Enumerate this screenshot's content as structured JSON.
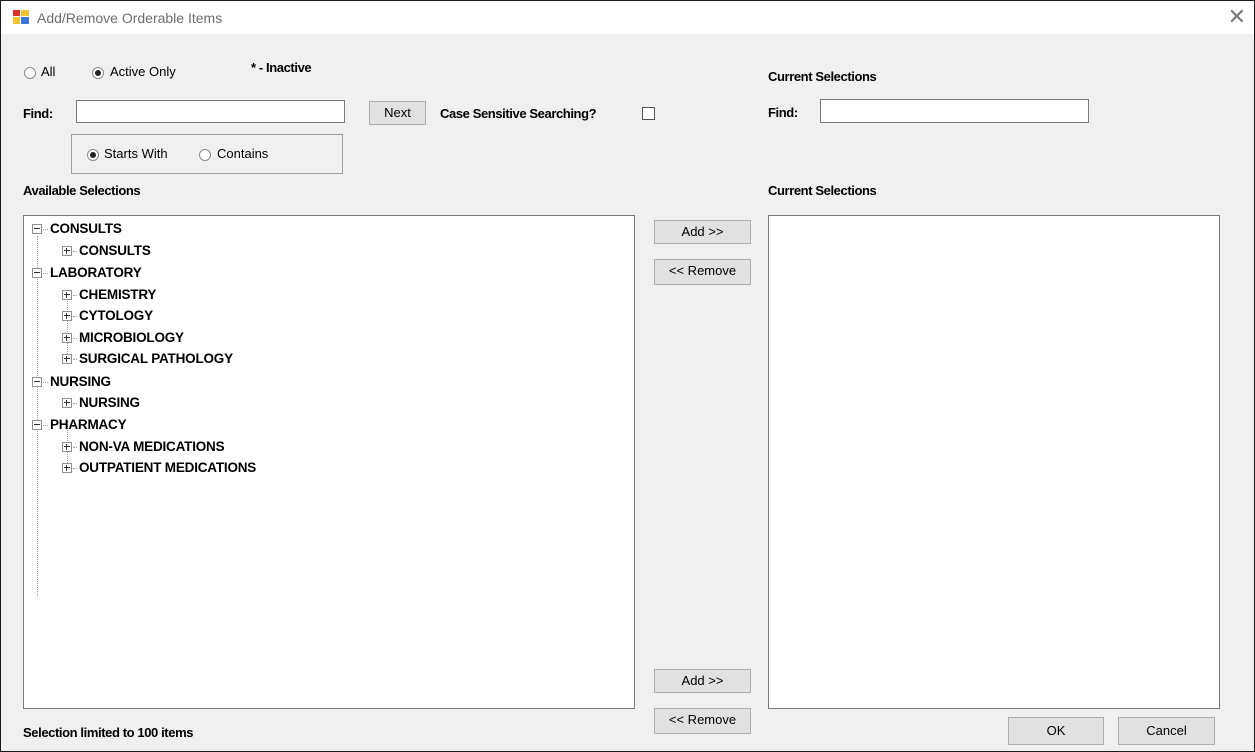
{
  "window": {
    "title": "Add/Remove Orderable Items"
  },
  "filter": {
    "all_label": "All",
    "active_only_label": "Active Only",
    "inactive_legend": "* - Inactive",
    "selected": "Active Only"
  },
  "find": {
    "label": "Find:",
    "value": "",
    "next_label": "Next",
    "case_sensitive_label": "Case Sensitive Searching?",
    "case_sensitive_checked": false
  },
  "match_mode": {
    "starts_with_label": "Starts With",
    "contains_label": "Contains",
    "selected": "Starts With"
  },
  "available": {
    "header": "Available Selections",
    "tree": [
      {
        "label": "CONSULTS",
        "expanded": true,
        "children": [
          "CONSULTS"
        ]
      },
      {
        "label": "LABORATORY",
        "expanded": true,
        "children": [
          "CHEMISTRY",
          "CYTOLOGY",
          "MICROBIOLOGY",
          "SURGICAL PATHOLOGY"
        ]
      },
      {
        "label": "NURSING",
        "expanded": true,
        "children": [
          "NURSING"
        ]
      },
      {
        "label": "PHARMACY",
        "expanded": true,
        "children": [
          "NON-VA MEDICATIONS",
          "OUTPATIENT MEDICATIONS"
        ]
      }
    ]
  },
  "transfer": {
    "add_label": "Add >>",
    "remove_label": "<< Remove"
  },
  "current": {
    "header": "Current Selections",
    "list_header": "Current Selections",
    "find_label": "Find:",
    "find_value": "",
    "items": []
  },
  "footer": {
    "limit_note": "Selection limited to 100 items",
    "ok_label": "OK",
    "cancel_label": "Cancel"
  },
  "colors": {
    "background": "#f0f0f0",
    "button": "#e1e1e1",
    "titlebar": "#ffffff"
  }
}
